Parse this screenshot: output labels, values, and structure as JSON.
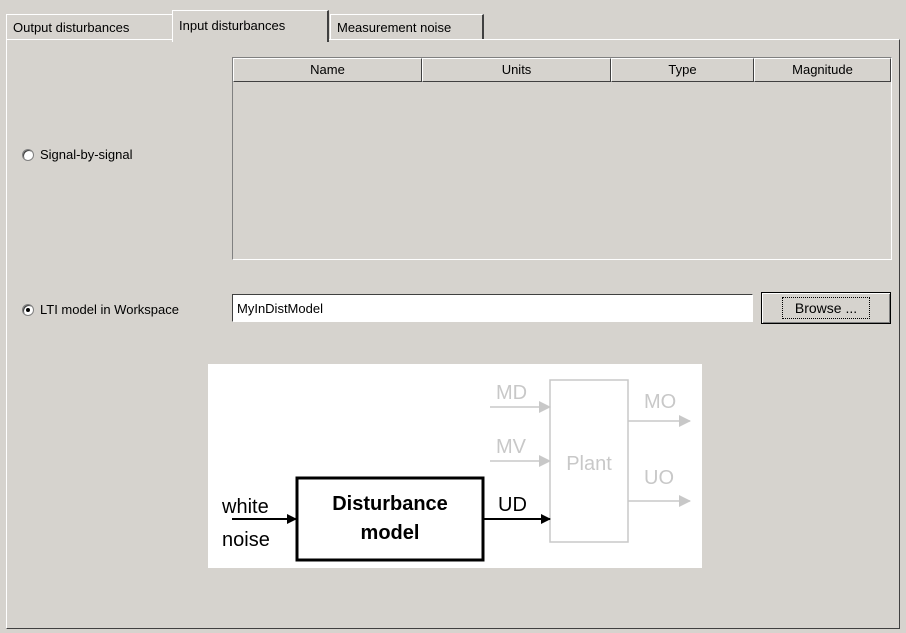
{
  "tabs": [
    {
      "label": "Output disturbances",
      "active": false
    },
    {
      "label": "Input disturbances",
      "active": true
    },
    {
      "label": "Measurement noise",
      "active": false
    }
  ],
  "signal_option": {
    "label": "Signal-by-signal",
    "checked": false
  },
  "table": {
    "columns": [
      "Name",
      "Units",
      "Type",
      "Magnitude"
    ],
    "rows": []
  },
  "lti_option": {
    "label": "LTI model in Workspace",
    "checked": true
  },
  "model_field": {
    "value": "MyInDistModel"
  },
  "browse_button": {
    "label": "Browse ..."
  },
  "diagram": {
    "input_label_1": "white",
    "input_label_2": "noise",
    "block_label_1": "Disturbance",
    "block_label_2": "model",
    "output_label": "UD",
    "plant_label": "Plant",
    "md_label": "MD",
    "mv_label": "MV",
    "mo_label": "MO",
    "uo_label": "UO",
    "colors": {
      "active": "#000000",
      "inactive": "#c8c8c8"
    }
  }
}
